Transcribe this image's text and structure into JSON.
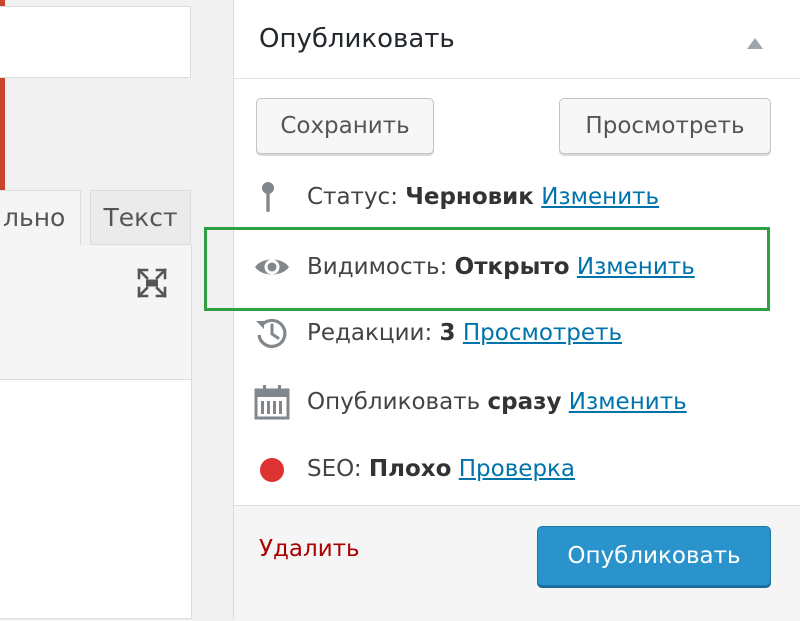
{
  "editor": {
    "tab_visual_label": "льно",
    "tab_text_label": "Текст"
  },
  "publish": {
    "title": "Опубликовать",
    "save_label": "Сохранить",
    "preview_label": "Просмотреть",
    "status": {
      "label": "Статус:",
      "value": "Черновик",
      "link": "Изменить"
    },
    "visibility": {
      "label": "Видимость:",
      "value": "Открыто",
      "link": "Изменить"
    },
    "revisions": {
      "label": "Редакции:",
      "value": "3",
      "link": "Просмотреть"
    },
    "schedule": {
      "label": "Опубликовать",
      "value": "сразу",
      "link": "Изменить"
    },
    "seo": {
      "label": "SEO:",
      "value": "Плохо",
      "link": "Проверка"
    },
    "delete_label": "Удалить",
    "publish_label": "Опубликовать"
  },
  "icons": {
    "status": "pin-icon",
    "visibility": "eye-icon",
    "revisions": "history-icon",
    "schedule": "calendar-icon",
    "seo": "red-dot-icon",
    "toggle": "triangle-up-icon",
    "expand": "fullscreen-icon"
  },
  "colors": {
    "link": "#0073aa",
    "publish_button": "#2b93cc",
    "delete": "#aa0000",
    "highlight": "#2ea043",
    "seo_dot": "#dc3232",
    "frame": "#c8452e"
  }
}
